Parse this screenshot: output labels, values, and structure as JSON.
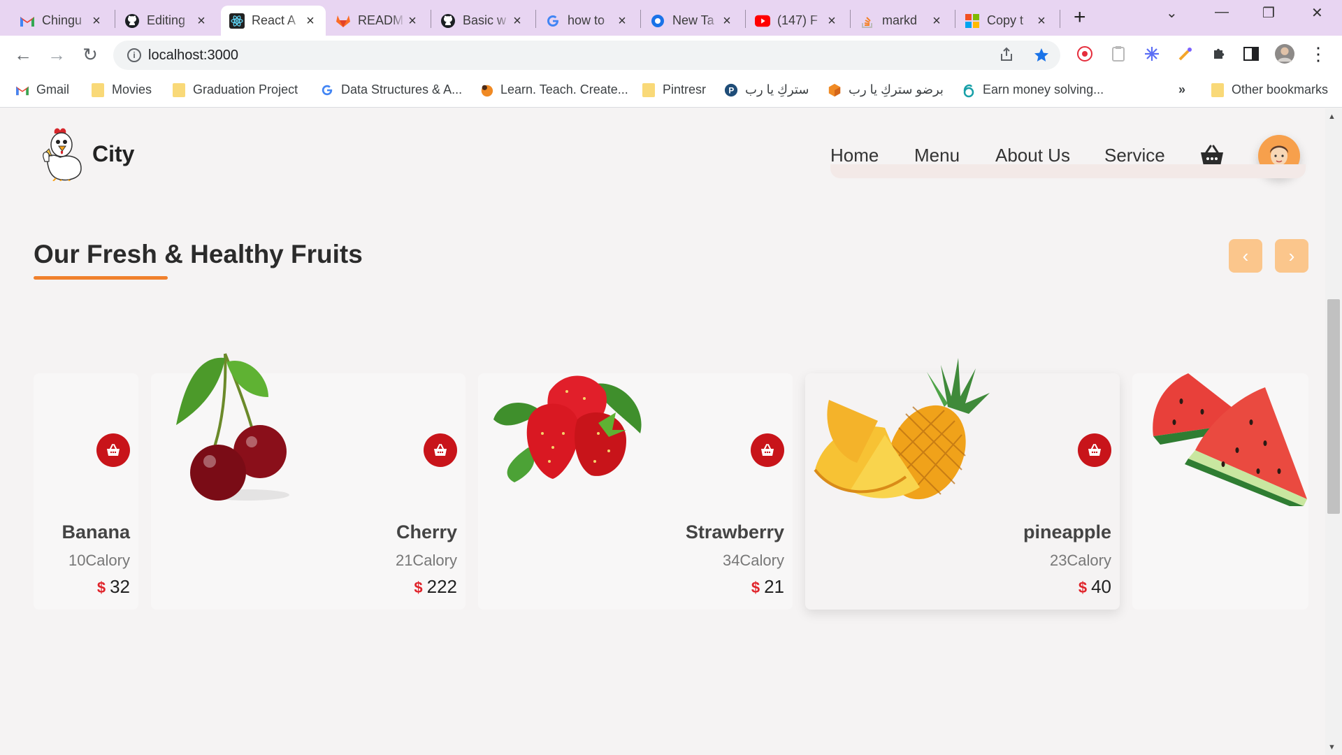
{
  "browser": {
    "tabs": [
      {
        "title": "Chingu",
        "icon": "gmail-icon"
      },
      {
        "title": "Editing",
        "icon": "github-icon"
      },
      {
        "title": "React A",
        "icon": "react-icon",
        "active": true
      },
      {
        "title": "READM",
        "icon": "gitlab-icon"
      },
      {
        "title": "Basic w",
        "icon": "github-icon"
      },
      {
        "title": "how to",
        "icon": "google-icon"
      },
      {
        "title": "New Ta",
        "icon": "chrome-icon"
      },
      {
        "title": "(147) F",
        "icon": "youtube-icon"
      },
      {
        "title": "markd",
        "icon": "stackoverflow-icon"
      },
      {
        "title": "Copy t",
        "icon": "microsoft-icon"
      }
    ],
    "url": "localhost:3000",
    "bookmarks": [
      {
        "label": "Gmail",
        "icon": "gmail-icon"
      },
      {
        "label": "Movies",
        "icon": "folder-icon"
      },
      {
        "label": "Graduation Project",
        "icon": "folder-icon"
      },
      {
        "label": "Data Structures & A...",
        "icon": "google-icon"
      },
      {
        "label": "Learn. Teach. Create...",
        "icon": "site-icon"
      },
      {
        "label": "Pintresr",
        "icon": "folder-icon"
      },
      {
        "label": "ستركِ يا رب",
        "icon": "pinterest-icon"
      },
      {
        "label": "برضو ستركِ يا رب",
        "icon": "box-icon"
      },
      {
        "label": "Earn money solving...",
        "icon": "site-icon"
      }
    ],
    "more_bookmarks": "»",
    "other_bookmarks": "Other bookmarks"
  },
  "header": {
    "brand": "City",
    "nav": [
      "Home",
      "Menu",
      "About Us",
      "Service"
    ]
  },
  "section": {
    "title": "Our Fresh & Healthy Fruits",
    "prev": "‹",
    "next": "›"
  },
  "products": [
    {
      "name": "Banana",
      "calories": "10Calory",
      "currency": "$",
      "price": "32"
    },
    {
      "name": "Cherry",
      "calories": "21Calory",
      "currency": "$",
      "price": "222"
    },
    {
      "name": "Strawberry",
      "calories": "34Calory",
      "currency": "$",
      "price": "21"
    },
    {
      "name": "pineapple",
      "calories": "23Calory",
      "currency": "$",
      "price": "40"
    }
  ],
  "colors": {
    "accent": "#f0802c",
    "cart_button": "#c8141a",
    "arrow_button": "#fbc68c",
    "price_symbol": "#e0242b"
  }
}
